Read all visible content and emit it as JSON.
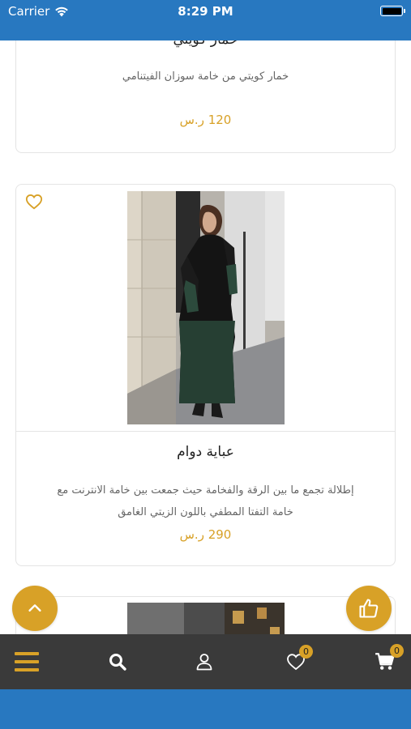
{
  "status_bar": {
    "carrier": "Carrier",
    "time": "8:29 PM"
  },
  "products": [
    {
      "title": "خمار كويتي",
      "description": "خمار كويتي من خامة سوزان الفيتنامي",
      "price": "120 ر.س"
    },
    {
      "title": "عباية دوام",
      "description_line1": "إطلالة تجمع ما بين الرقة والفخامة حيث جمعت بين خامة الانترنت مع",
      "description_line2": "خامة التفتا المطفي باللون الزيتي الغامق",
      "price": "290 ر.س"
    }
  ],
  "tab_bar": {
    "wishlist_count": "0",
    "cart_count": "0"
  },
  "colors": {
    "accent": "#d8a127",
    "status_bar": "#2878c0",
    "tab_bar": "#3a3a3a"
  },
  "icons": {
    "menu": "menu-icon",
    "search": "search-icon",
    "account": "user-icon",
    "wishlist": "heart-icon",
    "cart": "cart-icon",
    "scroll_top": "chevron-up-icon",
    "like": "thumbs-up-icon"
  }
}
